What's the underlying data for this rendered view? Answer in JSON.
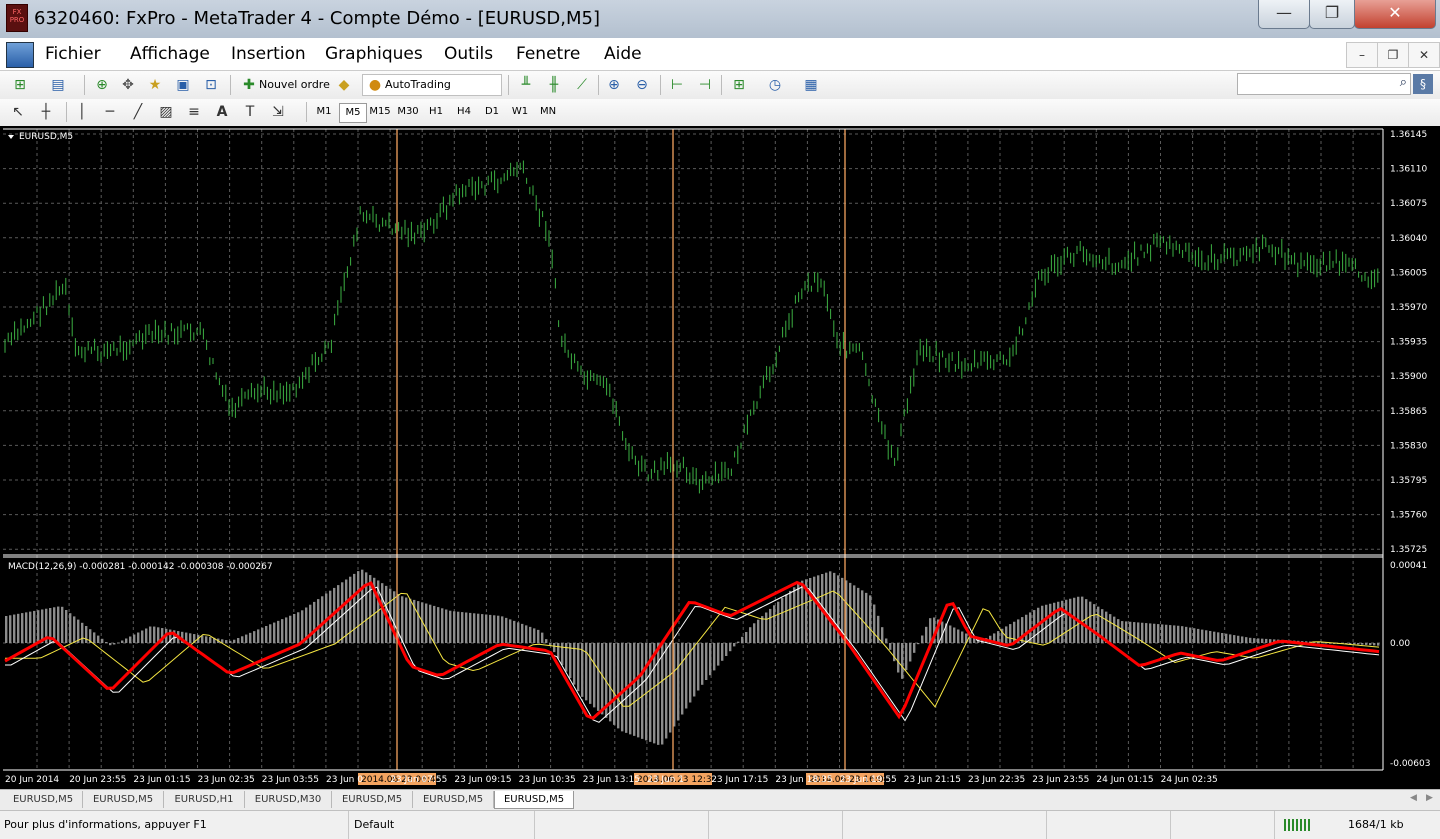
{
  "window": {
    "title": "6320460: FxPro - MetaTrader 4 - Compte Démo - [EURUSD,M5]",
    "minimize_glyph": "—",
    "maximize_glyph": "❐",
    "close_glyph": "✕",
    "app_icon_text": "FX PRO"
  },
  "menu": {
    "items": [
      "Fichier",
      "Affichage",
      "Insertion",
      "Graphiques",
      "Outils",
      "Fenetre",
      "Aide"
    ],
    "mdi_min": "–",
    "mdi_restore": "❐",
    "mdi_close": "✕"
  },
  "toolbar": {
    "new_order_label": "Nouvel ordre",
    "autotrading_label": "AutoTrading",
    "search_placeholder": "",
    "timeframes": [
      "M1",
      "M5",
      "M15",
      "M30",
      "H1",
      "H4",
      "D1",
      "W1",
      "MN"
    ],
    "active_timeframe": "M5"
  },
  "chart": {
    "symbol_label": "EURUSD,M5",
    "indicator_label": "MACD(12,26,9) -0.000281 -0.000142 -0.000308 -0.000267",
    "price_labels": [
      "1.36145",
      "1.36110",
      "1.36075",
      "1.36040",
      "1.36005",
      "1.35970",
      "1.35935",
      "1.35900",
      "1.35865",
      "1.35830",
      "1.35795",
      "1.35760",
      "1.35725"
    ],
    "macd_labels": [
      "0.00041",
      "0.00",
      "-0.00603"
    ],
    "time_labels": [
      "20 Jun 2014",
      "20 Jun 23:55",
      "23 Jun 01:15",
      "23 Jun 02:35",
      "23 Jun 03:55",
      "23 Jun 0",
      "23 Jun 07:55",
      "23 Jun 09:15",
      "23 Jun 10:35",
      "23 Jun 13:15",
      "23 Jun 1",
      "23 Jun 17:15",
      "23 Jun 18:35",
      "23 Jun 19:55",
      "23 Jun 21:15",
      "23 Jun 22:35",
      "23 Jun 23:55",
      "24 Jun 01:15",
      "24 Jun 02:35"
    ],
    "marker_labels": [
      "2014.06.23 06:45",
      "2014.06.23 12:30",
      "2014.06.23 16:05"
    ],
    "colors": {
      "background": "#000000",
      "candles": "#3cb043",
      "grid": "#5a5a5a",
      "histogram": "#8c8c8c",
      "macd_line": "#ff0000",
      "signal_yellow": "#f5e642",
      "signal_white": "#ffffff",
      "markers": "#f4a460"
    }
  },
  "tabs": {
    "items": [
      "EURUSD,M5",
      "EURUSD,M5",
      "EURUSD,H1",
      "EURUSD,M30",
      "EURUSD,M5",
      "EURUSD,M5",
      "EURUSD,M5"
    ],
    "active_index": 6
  },
  "status": {
    "help_text": "Pour plus d'informations, appuyer F1",
    "profile": "Default",
    "traffic": "1684/1 kb"
  }
}
